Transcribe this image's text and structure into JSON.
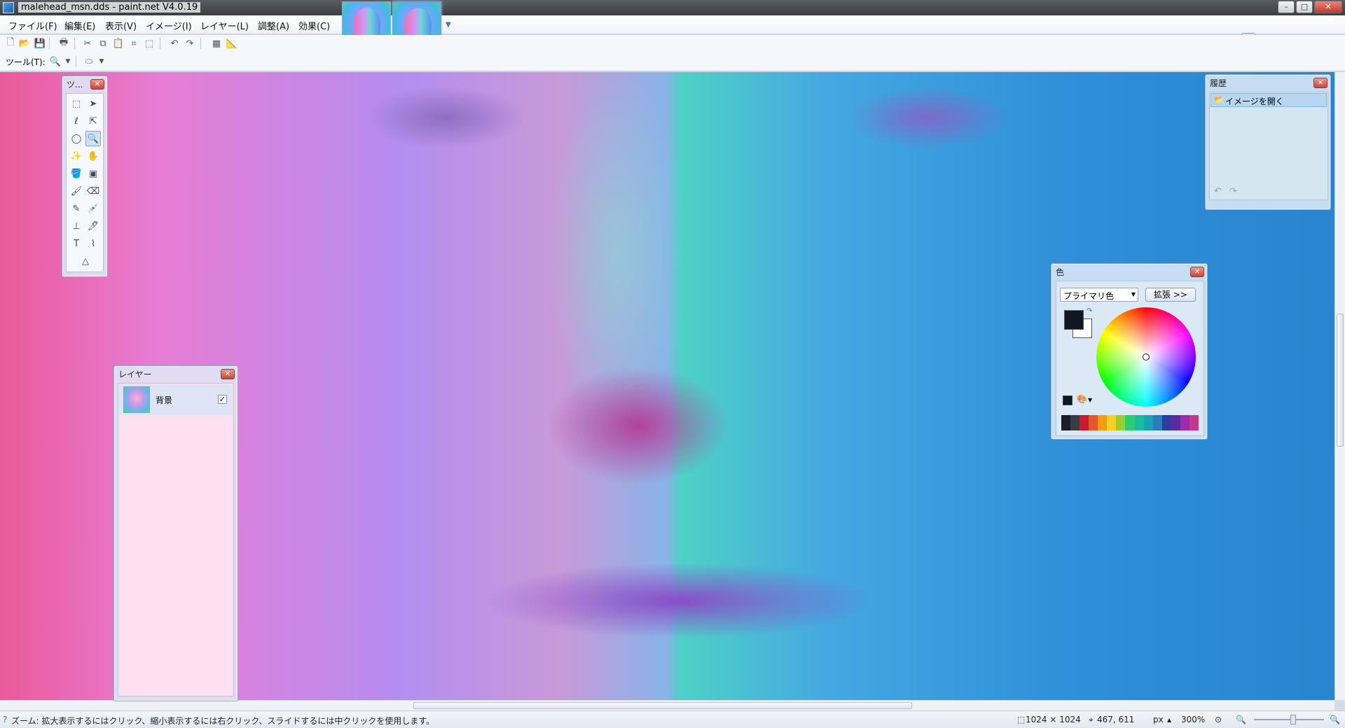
{
  "window": {
    "title": "malehead_msn.dds - paint.net V4.0.19"
  },
  "menu": {
    "items": [
      "ファイル(F)",
      "編集(E)",
      "表示(V)",
      "イメージ(I)",
      "レイヤー(L)",
      "調整(A)",
      "効果(C)"
    ]
  },
  "toolbar": {
    "tool_label": "ツール(T):"
  },
  "tools_panel": {
    "title": "ツ..."
  },
  "layers_panel": {
    "title": "レイヤー",
    "layers": [
      {
        "name": "背景",
        "visible": true
      }
    ]
  },
  "history_panel": {
    "title": "履歴",
    "items": [
      "イメージを開く"
    ]
  },
  "colors_panel": {
    "title": "色",
    "mode_select": "プライマリ色",
    "expand_button": "拡張 >>",
    "primary_color": "#0f1624",
    "secondary_color": "#ffffff",
    "palette": [
      "#1b1d26",
      "#3b3d45",
      "#c81c2e",
      "#e4572e",
      "#f39c12",
      "#f2d024",
      "#9acd32",
      "#2ecc71",
      "#1abc9c",
      "#17a2b8",
      "#2980b9",
      "#2c3e9f",
      "#5b2c9f",
      "#9b2caf",
      "#c0398f"
    ]
  },
  "statusbar": {
    "hint": "ズーム: 拡大表示するにはクリック、縮小表示するには右クリック、スライドするには中クリックを使用します。",
    "image_size": "1024 × 1024",
    "cursor_pos": "467, 611",
    "units": "px",
    "zoom": "300%"
  }
}
